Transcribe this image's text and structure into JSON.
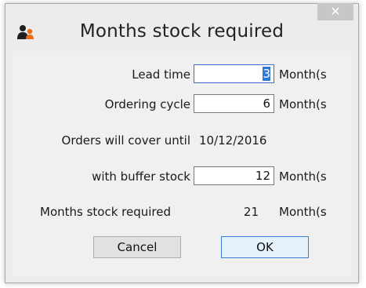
{
  "dialog": {
    "title": "Months stock required",
    "close_glyph": "✕"
  },
  "fields": {
    "lead_time": {
      "label": "Lead time",
      "value": "3",
      "unit": "Month(s"
    },
    "ordering_cycle": {
      "label": "Ordering cycle",
      "value": "6",
      "unit": "Month(s"
    },
    "buffer_stock": {
      "label": "with buffer stock",
      "value": "12",
      "unit": "Month(s"
    }
  },
  "info": {
    "orders_cover_label": "Orders will cover until",
    "orders_cover_value": "10/12/2016",
    "months_required_label": "Months stock required",
    "months_required_value": "21",
    "months_required_unit": "Month(s"
  },
  "buttons": {
    "cancel": "Cancel",
    "ok": "OK"
  },
  "icons": {
    "app": "users-icon",
    "close": "close-icon"
  },
  "colors": {
    "accent": "#3078d8",
    "icon_dark": "#1f1f1f",
    "icon_orange": "#e8701a"
  }
}
